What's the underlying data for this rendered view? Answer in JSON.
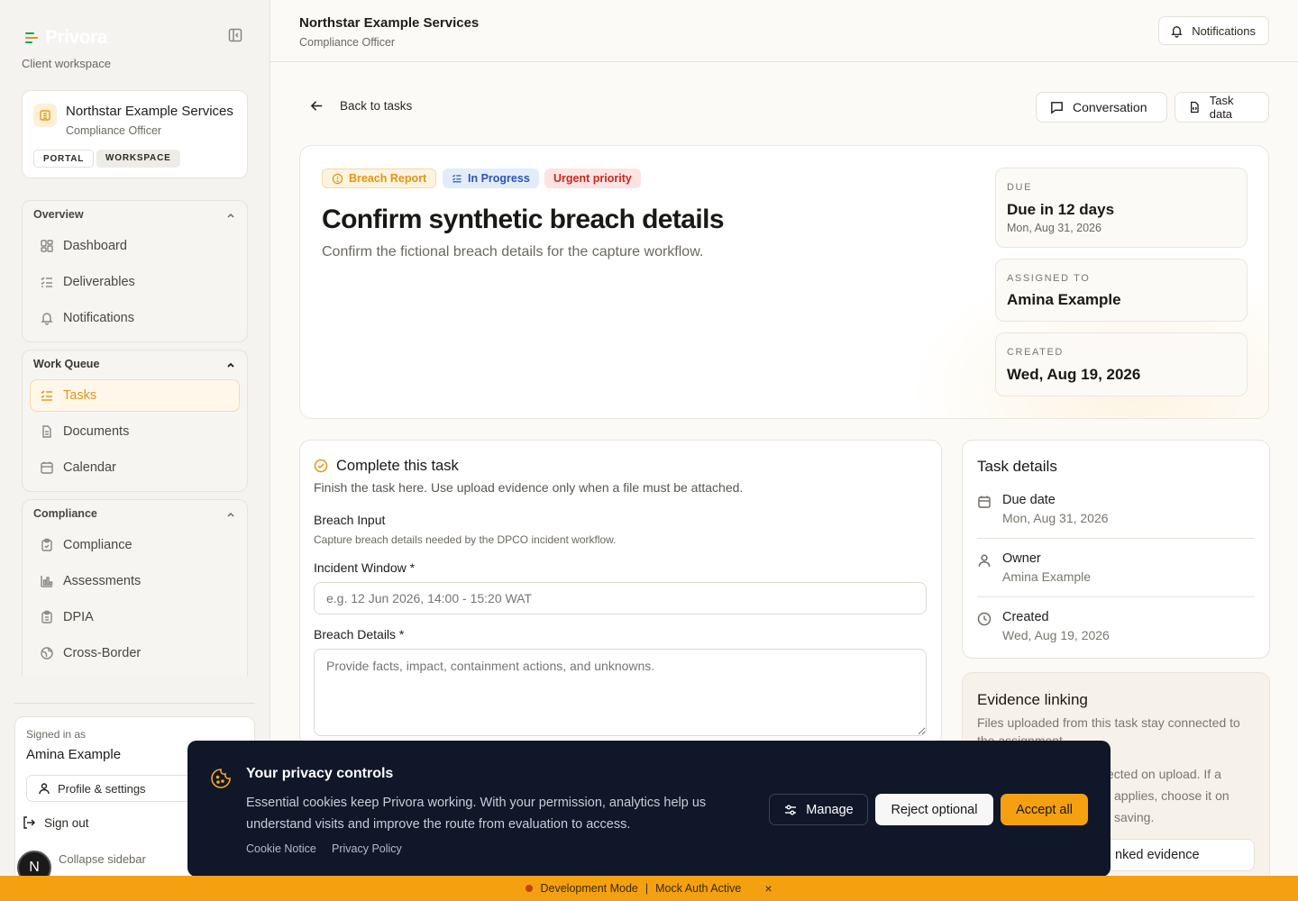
{
  "sidebar": {
    "logo_text": "Privora",
    "workspace_label": "Client workspace",
    "org": {
      "name": "Northstar Example Services",
      "role": "Compliance Officer",
      "badges": [
        "PORTAL",
        "WORKSPACE"
      ]
    },
    "groups": [
      {
        "title": "Overview",
        "items": [
          {
            "label": "Dashboard",
            "icon": "dashboard-icon"
          },
          {
            "label": "Deliverables",
            "icon": "list-check-icon"
          },
          {
            "label": "Notifications",
            "icon": "bell-icon"
          }
        ]
      },
      {
        "title": "Work Queue",
        "items": [
          {
            "label": "Tasks",
            "icon": "tasks-icon",
            "active": true
          },
          {
            "label": "Documents",
            "icon": "document-icon"
          },
          {
            "label": "Calendar",
            "icon": "calendar-icon"
          }
        ]
      },
      {
        "title": "Compliance",
        "items": [
          {
            "label": "Compliance",
            "icon": "clipboard-icon"
          },
          {
            "label": "Assessments",
            "icon": "bar-chart-icon"
          },
          {
            "label": "DPIA",
            "icon": "clipboard-check-icon"
          },
          {
            "label": "Cross-Border",
            "icon": "globe-icon"
          }
        ]
      }
    ],
    "user": {
      "signed_in_label": "Signed in as",
      "name": "Amina Example",
      "profile_label": "Profile & settings",
      "signout_label": "Sign out",
      "collapse_label": "Collapse sidebar",
      "avatar_letter": "N"
    }
  },
  "topbar": {
    "org_name": "Northstar Example Services",
    "role": "Compliance Officer",
    "notifications_label": "Notifications"
  },
  "actions": {
    "back_label": "Back to tasks",
    "conversation_label": "Conversation",
    "task_data_label": "Task data"
  },
  "task": {
    "tags": {
      "type": "Breach Report",
      "status": "In Progress",
      "priority": "Urgent priority"
    },
    "title": "Confirm synthetic breach details",
    "subtitle": "Confirm the fictional breach details for the capture workflow.",
    "meta": {
      "due_label": "DUE",
      "due_value": "Due in 12 days",
      "due_date": "Mon, Aug 31, 2026",
      "assigned_label": "ASSIGNED TO",
      "assigned_value": "Amina Example",
      "created_label": "CREATED",
      "created_value": "Wed, Aug 19, 2026"
    }
  },
  "complete": {
    "title": "Complete this task",
    "desc": "Finish the task here. Use upload evidence only when a file must be attached.",
    "section_title": "Breach Input",
    "section_desc": "Capture breach details needed by the DPCO incident workflow.",
    "incident_label": "Incident Window *",
    "incident_placeholder": "e.g. 12 Jun 2026, 14:00 - 15:20 WAT",
    "details_label": "Breach Details *",
    "details_placeholder": "Provide facts, impact, containment actions, and unknowns."
  },
  "details": {
    "title": "Task details",
    "rows": [
      {
        "label": "Due date",
        "value": "Mon, Aug 31, 2026"
      },
      {
        "label": "Owner",
        "value": "Amina Example"
      },
      {
        "label": "Created",
        "value": "Wed, Aug 19, 2026"
      }
    ]
  },
  "evidence": {
    "title": "Evidence linking",
    "desc": "Files uploaded from this task stay connected to the assignment.",
    "tail1": "ected on upload. If a",
    "tail2": "applies, choose it on",
    "tail3": "saving.",
    "button_tail": "nked evidence"
  },
  "cookie": {
    "title": "Your privacy controls",
    "text": "Essential cookies keep Privora working. With your permission, analytics help us understand visits and improve the route from evaluation to access.",
    "notice_link": "Cookie Notice",
    "policy_link": "Privacy Policy",
    "manage_label": "Manage",
    "reject_label": "Reject optional",
    "accept_label": "Accept all"
  },
  "devbar": {
    "mode": "Development Mode",
    "separator": "|",
    "auth": "Mock Auth Active",
    "close": "×"
  },
  "colors": {
    "accent": "#e39414",
    "cookie_bg": "#0f1729",
    "devbar": "#f5a010"
  }
}
